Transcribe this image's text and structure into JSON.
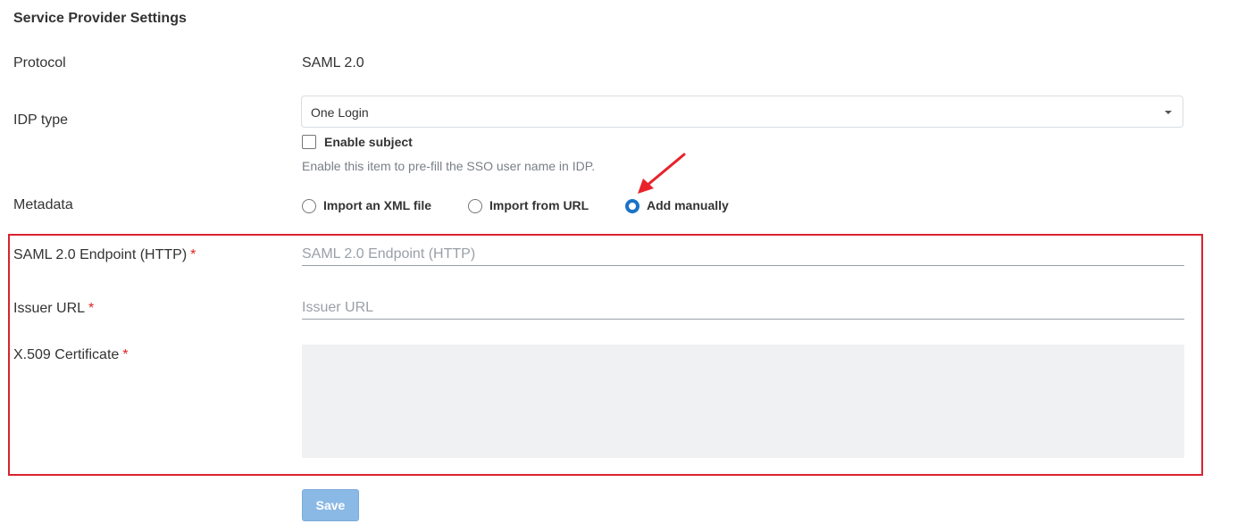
{
  "section": {
    "title": "Service Provider Settings"
  },
  "protocol": {
    "label": "Protocol",
    "value": "SAML 2.0"
  },
  "idp_type": {
    "label": "IDP type",
    "selected": "One Login",
    "enable_subject_label": "Enable subject",
    "enable_subject_checked": false,
    "help_text": "Enable this item to pre-fill the SSO user name in IDP."
  },
  "metadata": {
    "label": "Metadata",
    "options": [
      "Import an XML file",
      "Import from URL",
      "Add manually"
    ],
    "selected_index": 2
  },
  "fields": {
    "endpoint": {
      "label": "SAML 2.0 Endpoint (HTTP)",
      "required_mark": "*",
      "placeholder": "SAML 2.0 Endpoint (HTTP)"
    },
    "issuer": {
      "label": "Issuer URL",
      "required_mark": "*",
      "placeholder": "Issuer URL"
    },
    "certificate": {
      "label": "X.509 Certificate",
      "required_mark": "*"
    }
  },
  "actions": {
    "save_label": "Save"
  },
  "colors": {
    "accent": "#1a73c8",
    "highlight_border": "#d9232e",
    "required": "#e02020",
    "save_button_disabled": "#8bb9e6"
  }
}
